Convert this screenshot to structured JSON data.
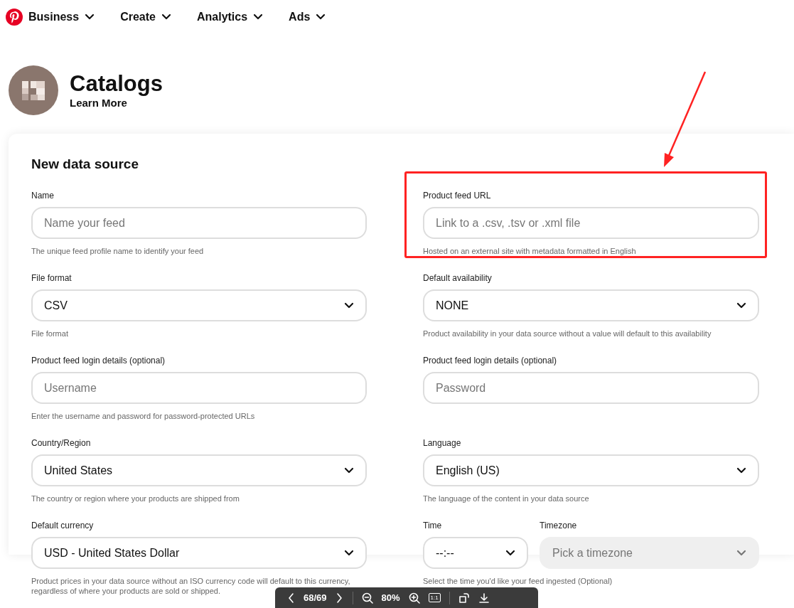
{
  "nav": {
    "items": [
      {
        "label": "Business"
      },
      {
        "label": "Create"
      },
      {
        "label": "Analytics"
      },
      {
        "label": "Ads"
      }
    ]
  },
  "header": {
    "title": "Catalogs",
    "link": "Learn More"
  },
  "form": {
    "title": "New data source",
    "rows": [
      {
        "groups": [
          {
            "kind": "plain",
            "fields": [
              {
                "label": "Name",
                "kind": "text",
                "placeholder": "Name your feed",
                "disabled": false
              }
            ],
            "help": "The unique feed profile name to identify your feed"
          },
          {
            "kind": "annotated",
            "fields": [
              {
                "label": "Product feed URL",
                "kind": "text",
                "placeholder": "Link to a .csv, .tsv or .xml file",
                "disabled": false
              }
            ],
            "help": "Hosted on an external site with metadata formatted in English"
          }
        ]
      },
      {
        "groups": [
          {
            "kind": "plain",
            "fields": [
              {
                "label": "File format",
                "kind": "select",
                "value": "CSV",
                "disabled": false
              }
            ],
            "help": "File format"
          },
          {
            "kind": "plain",
            "fields": [
              {
                "label": "Default availability",
                "kind": "select",
                "value": "NONE",
                "disabled": false
              }
            ],
            "help": "Product availability in your data source without a value will default to this availability"
          }
        ]
      },
      {
        "groups": [
          {
            "kind": "plain",
            "fields": [
              {
                "label": "Product feed login details (optional)",
                "kind": "text",
                "placeholder": "Username",
                "disabled": false
              }
            ],
            "help": "Enter the username and password for password-protected URLs"
          },
          {
            "kind": "plain",
            "fields": [
              {
                "label": "Product feed login details (optional)",
                "kind": "text",
                "placeholder": "Password",
                "disabled": false
              }
            ]
          }
        ]
      },
      {
        "groups": [
          {
            "kind": "plain",
            "fields": [
              {
                "label": "Country/Region",
                "kind": "select",
                "value": "United States",
                "disabled": false
              }
            ],
            "help": "The country or region where your products are shipped from"
          },
          {
            "kind": "plain",
            "fields": [
              {
                "label": "Language",
                "kind": "select",
                "value": "English (US)",
                "disabled": false
              }
            ],
            "help": "The language of the content in your data source"
          }
        ]
      },
      {
        "groups": [
          {
            "kind": "plain",
            "fields": [
              {
                "label": "Default currency",
                "kind": "select",
                "value": "USD - United States Dollar",
                "disabled": false
              }
            ],
            "help": "Product prices in your data source without an ISO currency code will default to this currency, regardless of where your products are sold or shipped."
          },
          {
            "kind": "plain",
            "fields": [
              {
                "label": "Time",
                "kind": "select",
                "value": "--:--",
                "disabled": false
              },
              {
                "label": "Timezone",
                "kind": "select",
                "value": "Pick a timezone",
                "disabled": true
              }
            ],
            "help": "Select the time you'd like your feed ingested (Optional)"
          }
        ]
      }
    ]
  },
  "viewer_toolbar": {
    "page": "68/69",
    "zoom": "80%",
    "actual_size": "1:1"
  }
}
